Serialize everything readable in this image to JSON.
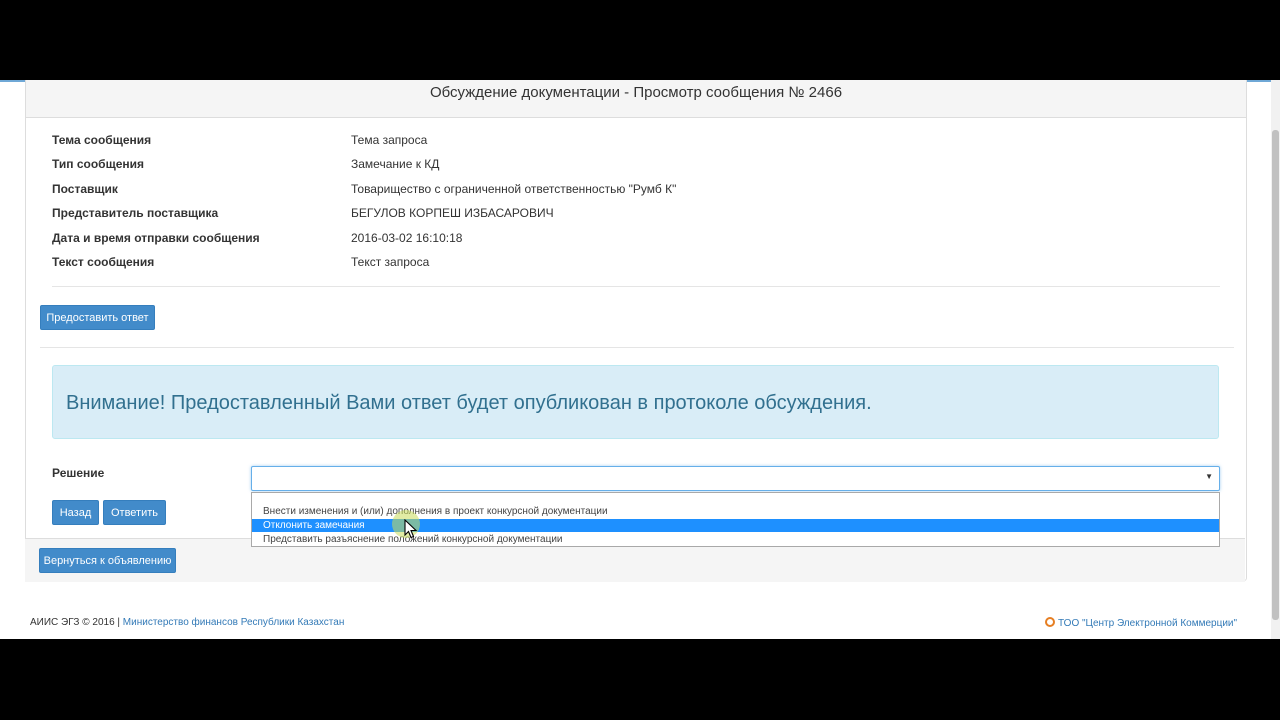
{
  "page": {
    "title": "Обсуждение документации - Просмотр сообщения № 2466"
  },
  "details": [
    {
      "label": "Тема сообщения",
      "value": "Тема запроса"
    },
    {
      "label": "Тип сообщения",
      "value": "Замечание к КД"
    },
    {
      "label": "Поставщик",
      "value": "Товарищество с ограниченной ответственностью \"Румб К\""
    },
    {
      "label": "Представитель поставщика",
      "value": "БЕГУЛОВ КОРПЕШ ИЗБАСАРОВИЧ"
    },
    {
      "label": "Дата и время отправки сообщения",
      "value": "2016-03-02 16:10:18"
    },
    {
      "label": "Текст сообщения",
      "value": "Текст запроса"
    }
  ],
  "buttons": {
    "provide_answer": "Предоставить ответ",
    "back": "Назад",
    "answer": "Ответить",
    "return_to_ad": "Вернуться к объявлению"
  },
  "alert": {
    "text": "Внимание! Предоставленный Вами ответ будет опубликован в протоколе обсуждения."
  },
  "decision": {
    "label": "Решение",
    "value": "",
    "options": [
      "Внести изменения и (или) дополнения в проект конкурсной документации",
      "Отклонить замечания",
      "Представить разъяснение положений конкурсной документации"
    ],
    "highlighted_option": "Отклонить замечания"
  },
  "footer": {
    "copyright": "АИИС ЭГЗ © 2016 |",
    "ministry_link": "Министерство финансов Республики Казахстан",
    "company_link": "ТОО \"Центр Электронной Коммерции\""
  },
  "colors": {
    "primary": "#428bca",
    "alert_bg": "#d9edf7",
    "alert_text": "#31708f",
    "selected_option": "#1e90ff"
  }
}
